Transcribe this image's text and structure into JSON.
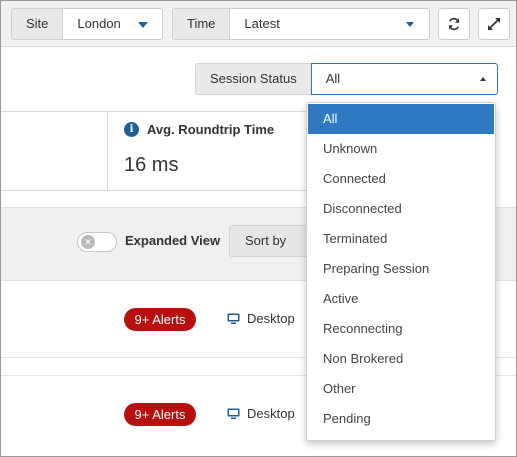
{
  "filters": {
    "site": {
      "label": "Site",
      "value": "London"
    },
    "time": {
      "label": "Time",
      "value": "Latest"
    }
  },
  "icons": {
    "refresh": "refresh-icon",
    "expand": "expand-icon",
    "info": "info-icon",
    "desktop": "desktop-icon"
  },
  "colors": {
    "accent": "#1f5f98",
    "selected": "#2f79c2",
    "alert": "#b80f0f"
  },
  "session_status": {
    "label": "Session Status",
    "value": "All",
    "options": [
      "All",
      "Unknown",
      "Connected",
      "Disconnected",
      "Terminated",
      "Preparing Session",
      "Active",
      "Reconnecting",
      "Non Brokered",
      "Other",
      "Pending"
    ]
  },
  "card": {
    "info_glyph": "i",
    "title": "Avg. Roundtrip Time",
    "value": "16 ms"
  },
  "toolbar": {
    "expanded_view_label": "Expanded View",
    "sort_by_label": "Sort by"
  },
  "rows": [
    {
      "alerts": "9+ Alerts",
      "type": "Desktop"
    },
    {
      "alerts": "9+ Alerts",
      "type": "Desktop"
    }
  ]
}
